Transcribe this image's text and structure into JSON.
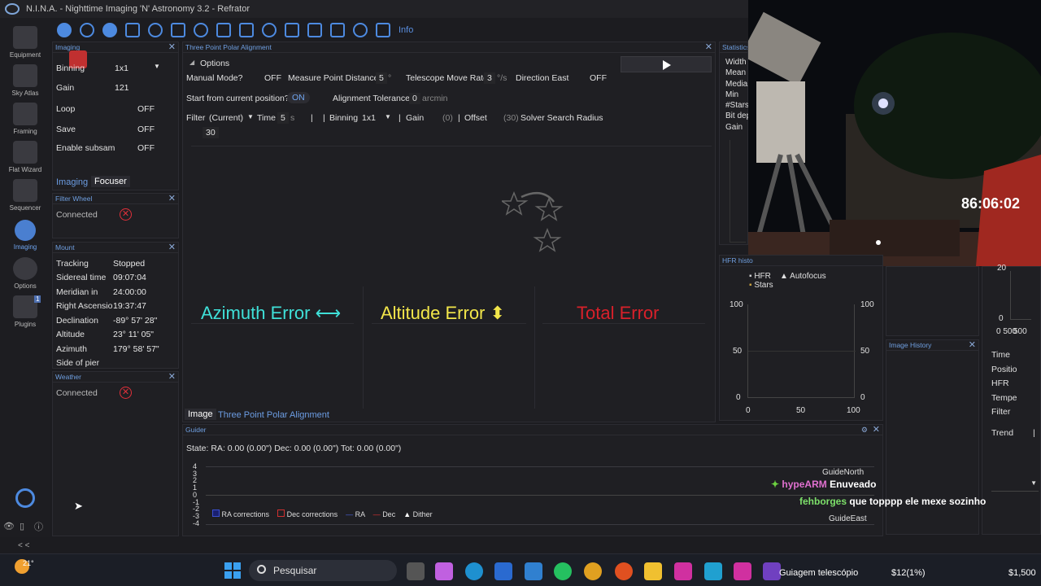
{
  "window": {
    "title": "N.I.N.A. - Nighttime Imaging 'N' Astronomy 3.2   -   Refrator"
  },
  "nav": {
    "items": [
      {
        "label": "Equipment"
      },
      {
        "label": "Sky Atlas"
      },
      {
        "label": "Framing"
      },
      {
        "label": "Flat Wizard"
      },
      {
        "label": "Sequencer"
      },
      {
        "label": "Imaging"
      },
      {
        "label": "Options"
      },
      {
        "label": "Plugins",
        "badge": "1"
      }
    ],
    "collapse": "< <"
  },
  "toolbar": {
    "info_label": "Info"
  },
  "imaging_panel": {
    "title": "Imaging",
    "rows": [
      {
        "label": "Binning",
        "value": "1x1"
      },
      {
        "label": "Gain",
        "value": "121"
      },
      {
        "label": "Loop",
        "value": "OFF"
      },
      {
        "label": "Save",
        "value": "OFF"
      },
      {
        "label": "Enable subsam",
        "value": "OFF"
      }
    ],
    "tabs": [
      "Imaging",
      "Focuser"
    ]
  },
  "filter_wheel": {
    "title": "Filter Wheel",
    "status": "Connected"
  },
  "mount": {
    "title": "Mount",
    "rows": [
      {
        "label": "Tracking",
        "value": "Stopped"
      },
      {
        "label": "Sidereal time",
        "value": "09:07:04"
      },
      {
        "label": "Meridian in",
        "value": "24:00:00"
      },
      {
        "label": "Right Ascensio",
        "value": "19:37:47"
      },
      {
        "label": "Declination",
        "value": "-89° 57' 28\""
      },
      {
        "label": "Altitude",
        "value": "23° 11' 05\""
      },
      {
        "label": "Azimuth",
        "value": "179° 58' 57\""
      },
      {
        "label": "Side of pier",
        "value": ""
      }
    ]
  },
  "weather": {
    "title": "Weather",
    "status": "Connected"
  },
  "tppa": {
    "title": "Three Point Polar Alignment",
    "options_label": "Options",
    "manual_mode": {
      "label": "Manual Mode?",
      "value": "OFF"
    },
    "measure_point": {
      "label": "Measure Point Distance",
      "value": "5",
      "unit": "°"
    },
    "move_rate": {
      "label": "Telescope Move Rate",
      "value": "3",
      "unit": "°/s"
    },
    "direction_east": {
      "label": "Direction East",
      "value": "OFF"
    },
    "start_current": {
      "label": "Start from current position?",
      "value": "ON"
    },
    "tolerance": {
      "label": "Alignment Tolerance",
      "value": "0",
      "unit": "arcmin"
    },
    "filter": {
      "label": "Filter",
      "value": "(Current)"
    },
    "time": {
      "label": "Time",
      "value": "5",
      "unit": "s"
    },
    "binning": {
      "label": "Binning",
      "value": "1x1"
    },
    "gain": {
      "label": "Gain",
      "value": "(0)"
    },
    "offset": {
      "label": "Offset",
      "value": "(30)"
    },
    "solver_radius": {
      "label": "Solver Search Radius",
      "value": "30"
    },
    "azimuth_error": "Azimuth Error ⟷",
    "altitude_error": "Altitude Error ⬍",
    "total_error": "Total Error",
    "tabs": [
      "Image",
      "Three Point Polar Alignment"
    ],
    "colors": {
      "azimuth": "#3fe0d8",
      "altitude": "#f2e64a",
      "total": "#d8202a"
    }
  },
  "guider": {
    "title": "Guider",
    "state": "State:  RA: 0.00 (0.00\")  Dec: 0.00 (0.00\")  Tot: 0.00 (0.00\")",
    "y_ticks": [
      "4",
      "3",
      "2",
      "1",
      "0",
      "-1",
      "-2",
      "-3",
      "-4"
    ],
    "legend": [
      "RA corrections",
      "Dec corrections",
      "RA",
      "Dec",
      "Dither"
    ],
    "guide_north": "GuideNorth",
    "guide_east": "GuideEast"
  },
  "statistics": {
    "title": "Statistics",
    "rows": [
      "Width",
      "Mean",
      "Media",
      "Min",
      "#Stars",
      "Bit dep",
      "Gain"
    ]
  },
  "webcam": {
    "timer": "86:06:02"
  },
  "hfr": {
    "title": "HFR histo",
    "legend": [
      "HFR",
      "Autofocus",
      "Stars"
    ],
    "y_ticks": [
      "100",
      "50",
      "0"
    ],
    "x_ticks": [
      "0",
      "50",
      "100"
    ]
  },
  "right_panel": {
    "ticks": [
      "20",
      "0",
      "0 500",
      "500"
    ],
    "rows": [
      "Time",
      "Positio",
      "HFR",
      "Tempe",
      "Filter",
      "Trend"
    ],
    "trend_value": "|"
  },
  "image_history": {
    "title": "Image History"
  },
  "chat": [
    {
      "user": "hypeARM",
      "message": "Enuveado",
      "color": "#e070d0"
    },
    {
      "user": "fehborges",
      "message": "que topppp ele mexe sozinho",
      "color": "#7de06a"
    }
  ],
  "taskbar": {
    "weather": "21°",
    "search_placeholder": "Pesquisar",
    "active_app": "Guiagem telescópio",
    "stock": "$12(1%)",
    "price": "$1,500"
  }
}
